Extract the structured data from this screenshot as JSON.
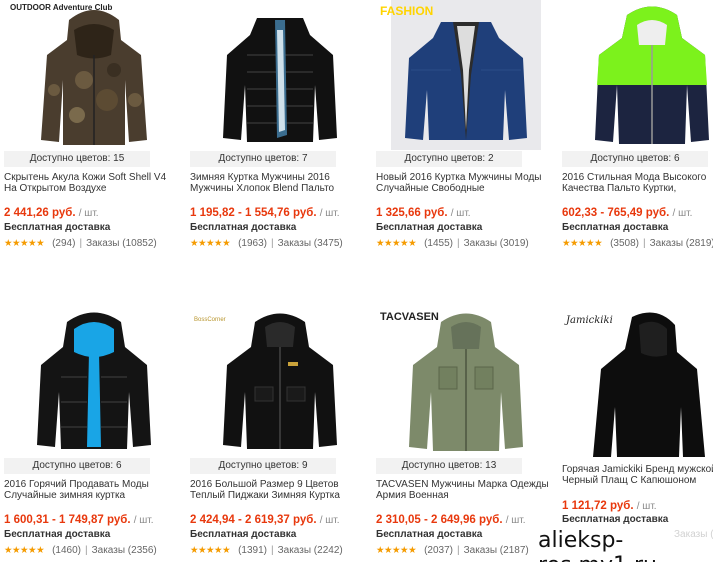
{
  "products": [
    {
      "image": "camo-softshell-hooded-jacket",
      "brand_logo": "OUTDOOR Adventure Club",
      "colors_label": "Доступно цветов: 15",
      "title": "Скрытень Акула Кожи Soft Shell V4 На Открытом Воздухе",
      "price": "2 441,26 руб.",
      "unit": "/ шт.",
      "shipping": "Бесплатная доставка",
      "stars": "★★★★★",
      "reviews": "(294)",
      "orders": "Заказы (10852)"
    },
    {
      "image": "black-puffer-jacket",
      "brand_logo": "",
      "colors_label": "Доступно цветов: 7",
      "title": "Зимняя Куртка Мужчины 2016 Мужчины Хлопок Blend Пальто",
      "price": "1 195,82 - 1 554,76 руб.",
      "unit": "/ шт.",
      "shipping": "Бесплатная доставка",
      "stars": "★★★★★",
      "reviews": "(1963)",
      "orders": "Заказы (3475)"
    },
    {
      "image": "blue-bomber-jacket",
      "brand_logo": "FASHION",
      "colors_label": "Доступно цветов: 2",
      "title": "Новый 2016 Куртка Мужчины Моды Случайные Свободные",
      "price": "1 325,66 руб.",
      "unit": "/ шт.",
      "shipping": "Бесплатная доставка",
      "stars": "★★★★★",
      "reviews": "(1455)",
      "orders": "Заказы (3019)"
    },
    {
      "image": "neon-green-windbreaker",
      "brand_logo": "",
      "colors_label": "Доступно цветов: 6",
      "title": "2016 Стильная Мода Высокого Качества Пальто Куртки,",
      "price": "602,33 - 765,49 руб.",
      "unit": "/ шт.",
      "shipping": "Бесплатная доставка",
      "stars": "★★★★★",
      "reviews": "(3508)",
      "orders": "Заказы (2819)"
    },
    {
      "image": "black-blue-hooded-puffer",
      "brand_logo": "",
      "colors_label": "Доступно цветов: 6",
      "title": "2016 Горячий Продавать Моды Случайные зимняя куртка",
      "price": "1 600,31 - 1 749,87 руб.",
      "unit": "/ шт.",
      "shipping": "Бесплатная доставка",
      "stars": "★★★★★",
      "reviews": "(1460)",
      "orders": "Заказы (2356)"
    },
    {
      "image": "black-ski-jacket",
      "brand_logo": "BossCorner",
      "colors_label": "Доступно цветов: 9",
      "title": "2016 Большой Размер 9 Цветов Теплый Пиджаки Зимняя Куртка",
      "price": "2 424,94 - 2 619,37 руб.",
      "unit": "/ шт.",
      "shipping": "Бесплатная доставка",
      "stars": "★★★★★",
      "reviews": "(1391)",
      "orders": "Заказы (2242)"
    },
    {
      "image": "olive-tactical-softshell",
      "brand_logo": "TACVASEN",
      "colors_label": "Доступно цветов: 13",
      "title": "TACVASEN Мужчины Марка Одежды Армия Военная",
      "price": "2 310,05 - 2 649,96 руб.",
      "unit": "/ шт.",
      "shipping": "Бесплатная доставка",
      "stars": "★★★★★",
      "reviews": "(2037)",
      "orders": "Заказы (2187)"
    },
    {
      "image": "black-hooded-cloak",
      "brand_logo": "Jamickiki",
      "colors_label": "",
      "title": "Горячая Jamickiki Бренд мужской Черный Плащ С Капюшоном",
      "price": "1 121,72 руб.",
      "unit": "/ шт.",
      "shipping": "Бесплатная доставка",
      "stars": "",
      "reviews": "",
      "orders": "Заказы (2115)"
    }
  ],
  "watermark": "alieksp­res.my1.ru",
  "colors": {
    "price": "#e8380d",
    "stars": "#f59b00",
    "pill": "#f2f2f2"
  }
}
